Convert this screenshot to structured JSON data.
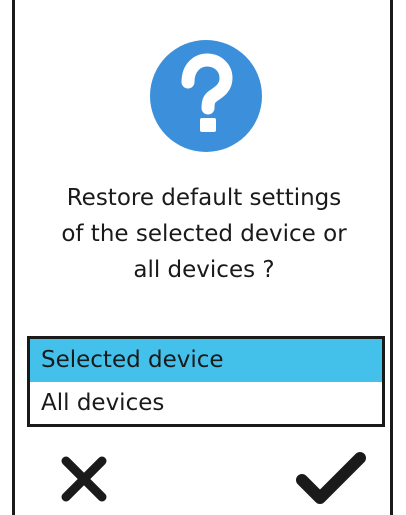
{
  "dialog": {
    "icon": "help-question-icon",
    "prompt_lines": [
      "Restore default settings",
      "of the selected device or",
      "all devices ?"
    ],
    "options": [
      {
        "label": "Selected device",
        "selected": true
      },
      {
        "label": "All devices",
        "selected": false
      }
    ],
    "cancel_icon": "close-icon",
    "confirm_icon": "checkmark-icon"
  },
  "colors": {
    "accent": "#3b8fdb",
    "selection": "#44c1ea",
    "foreground": "#1a1a1a",
    "background": "#ffffff"
  }
}
